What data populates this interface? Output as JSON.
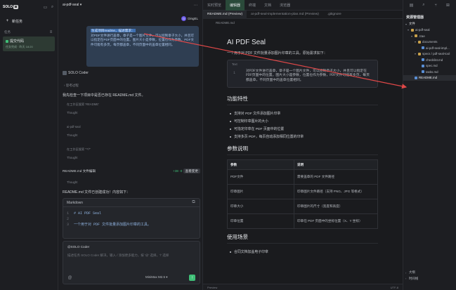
{
  "sidebar": {
    "logo_text": "SOLO",
    "new_task": "新任务",
    "section": "任务",
    "section_count": "1",
    "task_title": "提交代码",
    "task_sub": "任务完成 · 昨天 18:20"
  },
  "chat": {
    "project": "ai-pdf-seal",
    "user": "DingEL",
    "bubble_hl": "生成项目readme，描述需求：",
    "bubble_text": "对PDF文件进行盖章，章子是一个图片文件，可以控制章子大小，并且可以指定在PDF页面中的位置。图片大小是参数，位置也作为参数，PDF文件可能有多页，每页都盖章，不同页面中的盖章位置相同。",
    "agent": "SOLO Coder",
    "think1": "思考过程",
    "line1": "我先检查一下项目中是否已存在 README.md 文件。",
    "step1": "在工作区搜索 'README'",
    "thought1": "Thought",
    "step2": "ai-pdf-seal",
    "thought2": "Thought",
    "step3": "在工作区搜索 '**/*'",
    "thought3": "Thought",
    "file_name": "README.md 文件编辑",
    "file_diff": "+38 -0",
    "file_btn": "查看变更",
    "thought4": "Thought",
    "result": "README.md 文件已创建成功！内容如下：",
    "code_lang": "Markdown",
    "code_lines": [
      {
        "n": "1",
        "c": "# AI PDF Seal"
      },
      {
        "n": "2",
        "c": ""
      },
      {
        "n": "3",
        "c": "一个用于对 PDF 文件批量添加图片印章的工具。"
      }
    ],
    "input_at": "@SOLO Coder",
    "input_ph": "描述任务 SOLO Coder 解决，输入 / 添加更多能力，按 '@' 选择，'/' 选择",
    "model": "MiniMax M2.5"
  },
  "editor": {
    "top_tabs": [
      "实时预览",
      "编辑器",
      "终端",
      "文档",
      "浏览器"
    ],
    "active_top": "编辑器",
    "file_tabs": [
      "README.md (Preview)",
      "ai-pdf-seal-implementation-plan.md (Preview)",
      ".gitignore"
    ],
    "active_file": "README.md (Preview)",
    "breadcrumb": "README.md",
    "h1": "AI PDF Seal",
    "intro": "一个用于对 PDF 文件批量添加图片印章的工具。原始需求如下：",
    "quote_label": "Text",
    "quote_num": "1",
    "quote_text": "对PDF文件进行盖章，章子是一个图片文件，可以控制章子大小，并且可以指定在PDF页面中的位置。图片大小是参数，位置也作为参数，PDF文件可能有多页，每页都盖章，不同页面中的盖章位置相同。",
    "features_title": "功能特性",
    "features": [
      "支持对 PDF 文件添加图片印章",
      "可控制印章图片的大小",
      "可指定印章在 PDF 页面中的位置",
      "支持多页 PDF，每页自动添加相同位置的印章"
    ],
    "params_title": "参数说明",
    "table_head": [
      "参数",
      "说明"
    ],
    "table_rows": [
      [
        "PDF文件",
        "需要盖章的 PDF 文件路径"
      ],
      [
        "印章图片",
        "印章图片文件路径（支持 PNG、JPG 等格式）"
      ],
      [
        "印章大小",
        "印章图片的尺寸（宽度和高度）"
      ],
      [
        "印章位置",
        "印章在 PDF 页面中的坐标位置（X、Y 坐标）"
      ]
    ],
    "usage_title": "使用场景",
    "usage": [
      "合同文档加盖电子印章"
    ],
    "status_left": "Preview",
    "status_right": "UTF-8"
  },
  "explorer": {
    "title": "资源管理器",
    "section": "文件",
    "rows": [
      {
        "label": "ai-pdf-seal",
        "depth": 0,
        "type": "folder"
      },
      {
        "label": ".trae",
        "depth": 1,
        "type": "folder"
      },
      {
        "label": "documents",
        "depth": 2,
        "type": "folder"
      },
      {
        "label": "ai-pdf-seal-impl...",
        "depth": 3,
        "type": "file"
      },
      {
        "label": "specs / pdf-seal-tool",
        "depth": 2,
        "type": "folder"
      },
      {
        "label": "checklist.md",
        "depth": 3,
        "type": "file"
      },
      {
        "label": "spec.md",
        "depth": 3,
        "type": "file"
      },
      {
        "label": "tasks.md",
        "depth": 3,
        "type": "file"
      },
      {
        "label": "README.md",
        "depth": 1,
        "type": "file"
      }
    ],
    "outline": "大纲",
    "timeline": "时间线"
  },
  "colors": {
    "accent": "#3fbf77",
    "highlight": "#3e6fb0",
    "arrow": "#e04848"
  }
}
